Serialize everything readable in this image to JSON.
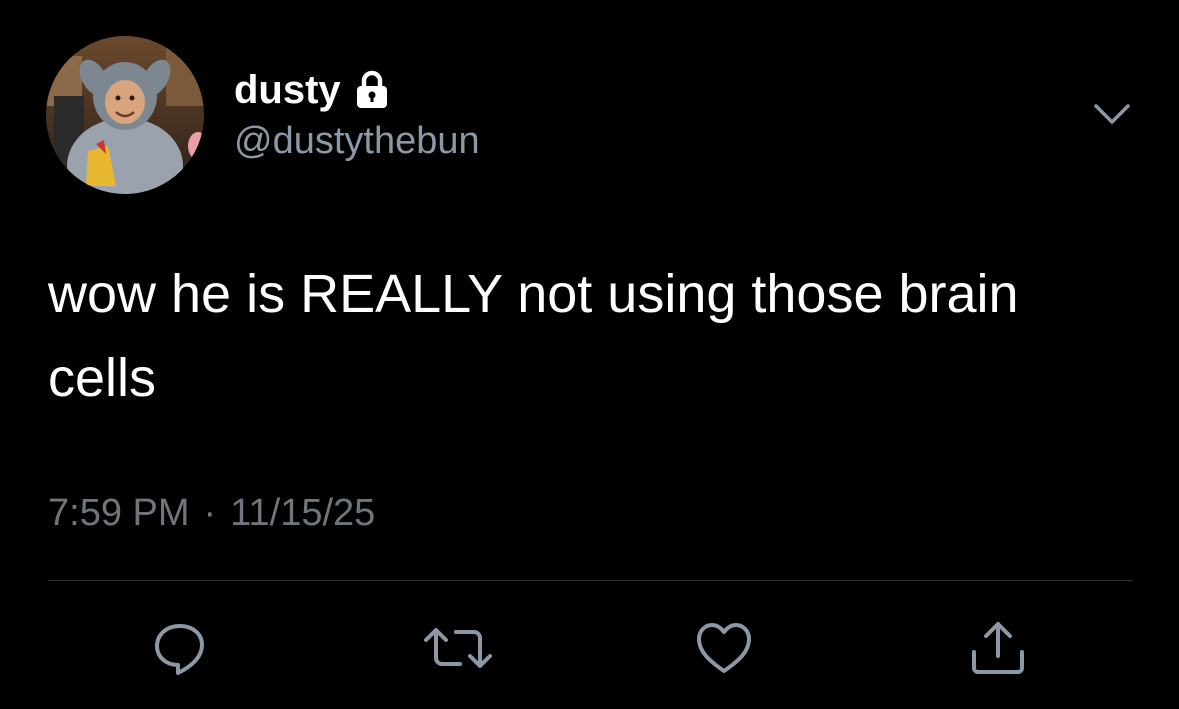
{
  "user": {
    "display_name": "dusty",
    "handle": "@dustythebun",
    "avatar_icon": "profile-photo",
    "lock_icon": "lock-icon"
  },
  "tweet": {
    "text": "wow he is REALLY not using those brain cells",
    "time": "7:59 PM",
    "separator": "·",
    "date": "11/15/25"
  },
  "actions": {
    "reply_icon": "reply-icon",
    "retweet_icon": "retweet-icon",
    "like_icon": "heart-icon",
    "share_icon": "share-icon"
  },
  "colors": {
    "background": "#000000",
    "text": "#ffffff",
    "secondary_text": "#8b98a5",
    "icon": "#8b98a5"
  }
}
